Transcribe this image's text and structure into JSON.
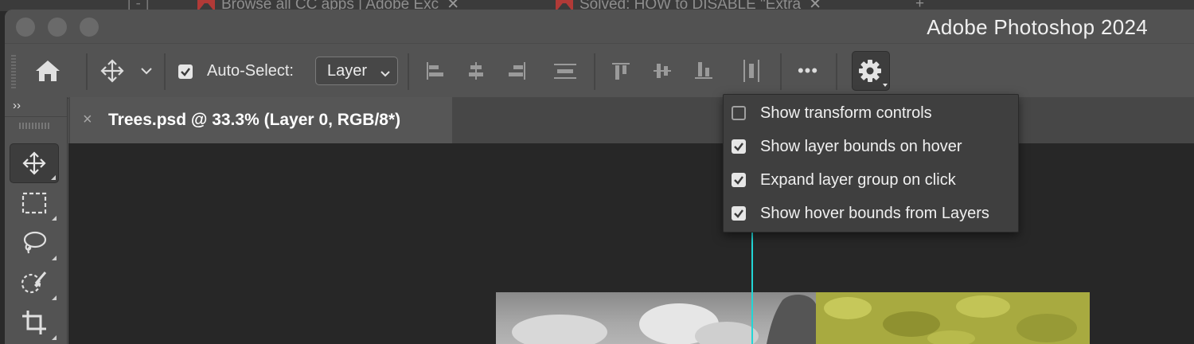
{
  "browser_tabs": [
    {
      "label": "Browse all CC apps | Adobe Exc"
    },
    {
      "label": "Solved: HOW to DISABLE \"Extra"
    }
  ],
  "window": {
    "title": "Adobe Photoshop 2024"
  },
  "options_bar": {
    "home_icon": "home-icon",
    "move_icon": "move-icon",
    "auto_select_label": "Auto-Select:",
    "auto_select_checked": true,
    "target_select_value": "Layer",
    "more_label": "•••",
    "settings_icon": "gear-icon"
  },
  "document": {
    "tab_title": "Trees.psd @ 33.3% (Layer 0, RGB/8*)",
    "close_glyph": "×"
  },
  "settings_menu": {
    "items": [
      {
        "label": "Show transform controls",
        "checked": false
      },
      {
        "label": "Show layer bounds on hover",
        "checked": true
      },
      {
        "label": "Expand layer group on click",
        "checked": true
      },
      {
        "label": "Show hover bounds from Layers",
        "checked": true
      }
    ]
  },
  "toolbar": {
    "collapse_glyph": "››",
    "tools": [
      "move-tool",
      "rectangular-marquee-tool",
      "lasso-tool",
      "object-selection-tool",
      "crop-tool"
    ]
  },
  "colors": {
    "guide": "#22d6d6",
    "panel": "#535353",
    "canvas": "#272727",
    "menu_bg": "#3f3f3f"
  }
}
